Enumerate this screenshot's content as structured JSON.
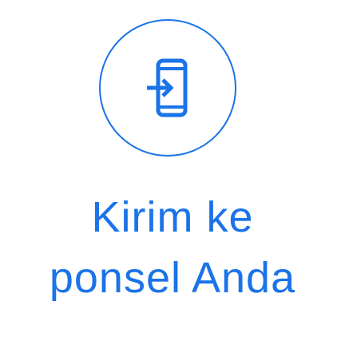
{
  "card": {
    "label_line1": "Kirim ke",
    "label_line2": "ponsel Anda",
    "icon": "send-to-phone-icon",
    "accent_color": "#1a73e8"
  }
}
